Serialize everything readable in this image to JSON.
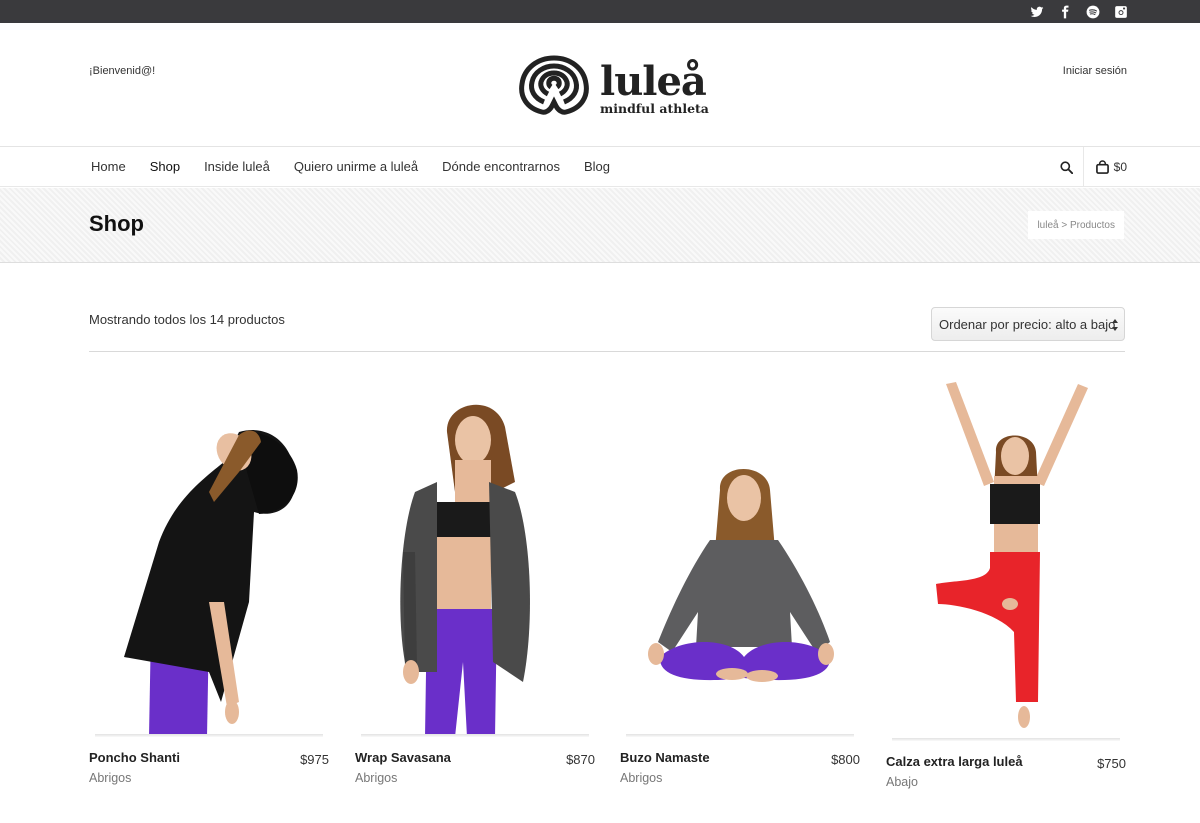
{
  "topbar": {
    "social_icons": [
      "twitter-icon",
      "facebook-icon",
      "spotify-icon",
      "instagram-icon"
    ]
  },
  "header": {
    "welcome": "¡Bienvenid@!",
    "login": "Iniciar sesión",
    "logo_name": "luleå",
    "logo_tagline": "mindful athleta"
  },
  "nav": {
    "items": [
      "Home",
      "Shop",
      "Inside luleå",
      "Quiero unirme a luleå",
      "Dónde encontrarnos",
      "Blog"
    ],
    "active": "Shop",
    "cart_total": "$0"
  },
  "page": {
    "title": "Shop",
    "breadcrumb": "luleå > Productos"
  },
  "shop": {
    "result_count": "Mostrando todos los 14 productos",
    "sort_selected": "Ordenar por precio: alto a bajo"
  },
  "products": [
    {
      "name": "Poncho Shanti",
      "price": "$975",
      "category": "Abrigos"
    },
    {
      "name": "Wrap Savasana",
      "price": "$870",
      "category": "Abrigos"
    },
    {
      "name": "Buzo Namaste",
      "price": "$800",
      "category": "Abrigos"
    },
    {
      "name": "Calza extra larga luleå",
      "price": "$750",
      "category": "Abajo"
    }
  ],
  "colors": {
    "topbar": "#3a3a3d",
    "leggings_purple": "#6a2fc9",
    "leggings_red": "#e8242a"
  }
}
